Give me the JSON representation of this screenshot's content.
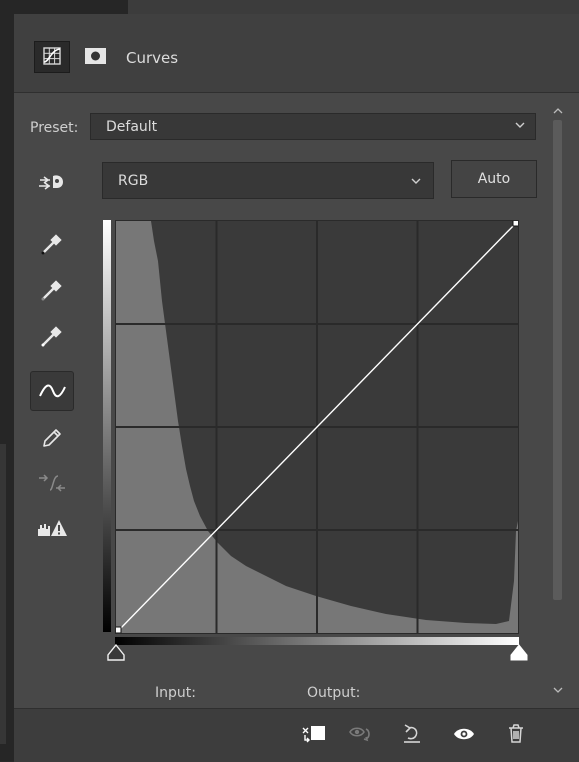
{
  "panel": {
    "title": "Curves"
  },
  "preset": {
    "label": "Preset:",
    "value": "Default"
  },
  "channel": {
    "value": "RGB"
  },
  "auto_label": "Auto",
  "graph": {
    "input_label": "Input:",
    "output_label": "Output:",
    "grid_divisions": 4,
    "curve_points": [
      [
        0,
        0
      ],
      [
        255,
        255
      ]
    ],
    "histogram": "left-heavy"
  },
  "tools": [
    "on-image-adjust-icon",
    "black-point-eyedropper-icon",
    "gray-point-eyedropper-icon",
    "white-point-eyedropper-icon",
    "curve-point-icon",
    "pencil-icon",
    "smooth-curve-icon",
    "clipping-warning-icon"
  ],
  "footer_icons": [
    "clip-to-layer-icon",
    "view-previous-state-icon",
    "reset-icon",
    "visibility-eye-icon",
    "trash-icon"
  ],
  "colors": {
    "panel_bg": "#484848",
    "header_bg": "#404040",
    "graph_bg": "#3a3a3a",
    "histogram": "#777777",
    "grid": "#2a2a2a",
    "curve": "#ffffff"
  }
}
